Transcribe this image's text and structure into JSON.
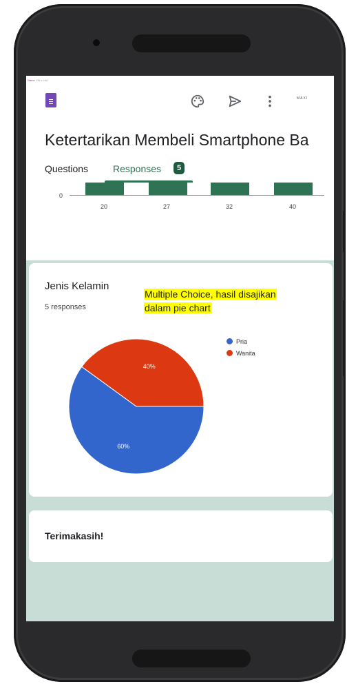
{
  "header": {
    "frame_tag": "Name",
    "frame_tag_dim": "146 x 146",
    "avatar_text": "MAXI"
  },
  "form": {
    "title": "Ketertarikan Membeli Smartphone Ba",
    "tabs": [
      {
        "label": "Questions"
      },
      {
        "label": "Responses"
      }
    ],
    "response_count": "5"
  },
  "age_chart": {
    "zero_label": "0",
    "categories": [
      "20",
      "27",
      "32",
      "40"
    ]
  },
  "gender_question": {
    "title": "Jenis Kelamin",
    "responses": "5 responses",
    "annotation_line1": "Multiple Choice, hasil disajikan",
    "annotation_line2": "dalam pie chart"
  },
  "chart_data": {
    "type": "pie",
    "slices": [
      {
        "label": "Pria",
        "value": 60,
        "display": "60%",
        "color": "#3366cc"
      },
      {
        "label": "Wanita",
        "value": 40,
        "display": "40%",
        "color": "#dc3912"
      }
    ],
    "legend_position": "right"
  },
  "closing": {
    "text": "Terimakasih!"
  },
  "colors": {
    "accent": "#2e7354",
    "badge": "#1e5c3f",
    "screen_bg": "#c8ddd5",
    "forms_icon": "#7248b9"
  }
}
